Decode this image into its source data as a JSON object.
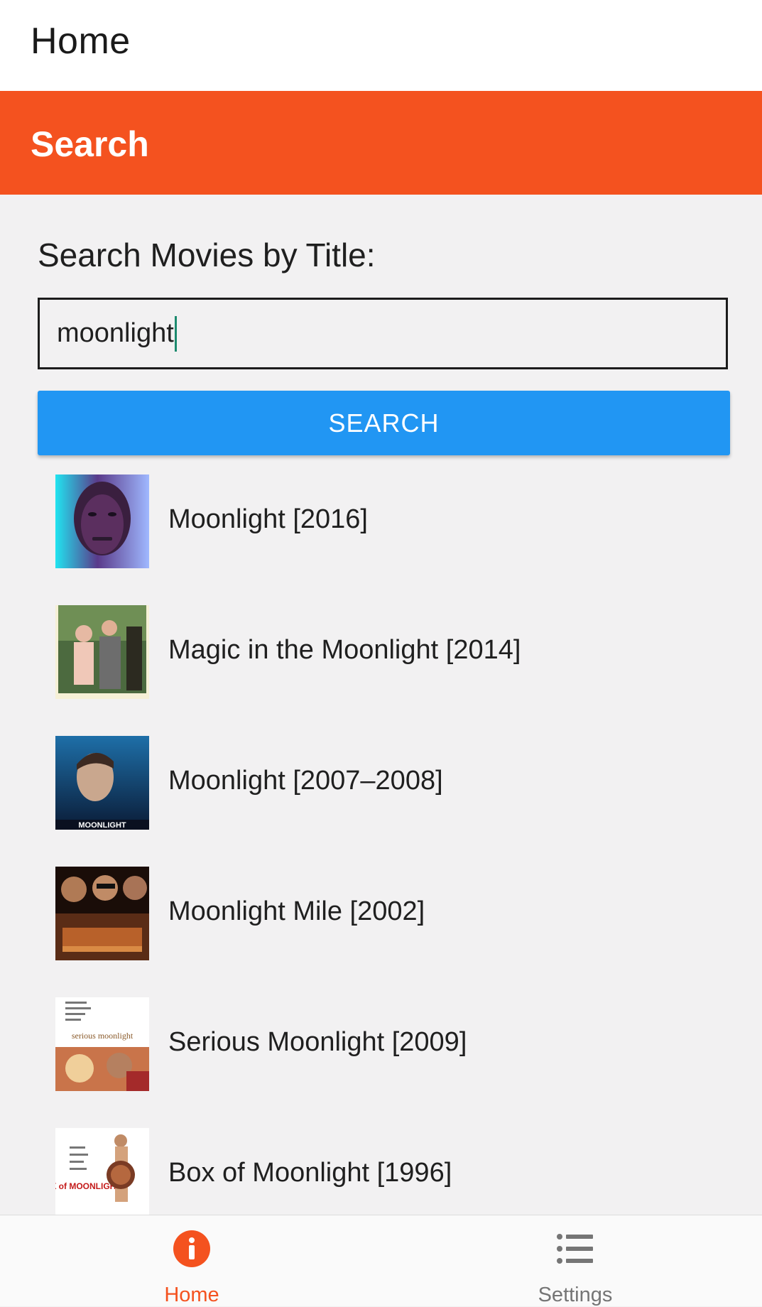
{
  "app_header": {
    "title": "Home"
  },
  "section_bar": {
    "title": "Search"
  },
  "search": {
    "label": "Search Movies by Title:",
    "value": "moonlight",
    "button_label": "SEARCH"
  },
  "results": [
    {
      "label": "Moonlight [2016]",
      "thumb_text": ""
    },
    {
      "label": "Magic in the Moonlight [2014]",
      "thumb_text": ""
    },
    {
      "label": "Moonlight [2007–2008]",
      "thumb_text": "MOONLIGHT"
    },
    {
      "label": "Moonlight Mile [2002]",
      "thumb_text": ""
    },
    {
      "label": "Serious Moonlight [2009]",
      "thumb_text": "serious moonlight"
    },
    {
      "label": "Box of Moonlight [1996]",
      "thumb_text": "BOX of MOONLIGHT"
    }
  ],
  "bottom_nav": {
    "items": [
      {
        "label": "Home",
        "icon": "info-circle-icon",
        "active": true
      },
      {
        "label": "Settings",
        "icon": "list-icon",
        "active": false
      }
    ]
  },
  "colors": {
    "accent": "#f4521f",
    "button": "#2196f3",
    "nav_active": "#f4521f",
    "nav_inactive": "#757575"
  }
}
